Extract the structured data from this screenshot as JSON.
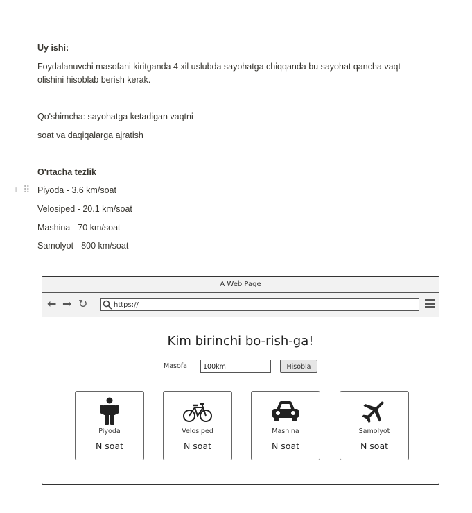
{
  "doc": {
    "heading": "Uy ishi:",
    "task_line1": "Foydalanuvchi masofani kiritganda 4 xil uslubda sayohatga chiqqanda bu sayohat qancha vaqt",
    "task_line2": "olishini hisoblab berish kerak.",
    "extra_line1": "Qo'shimcha: sayohatga ketadigan vaqtni",
    "extra_line2": "soat va daqiqalarga ajratish",
    "speed_heading": "O'rtacha tezlik",
    "speeds": [
      "Piyoda - 3.6 km/soat",
      "Velosiped - 20.1 km/soat",
      "Mashina - 70 km/soat",
      "Samolyot - 800 km/soat"
    ]
  },
  "wireframe": {
    "window_title": "A Web Page",
    "url": "https://",
    "page_heading": "Kim birinchi bo-rish-ga!",
    "distance_label": "Masofa",
    "distance_value": "100km",
    "calc_button": "Hisobla",
    "cards": [
      {
        "name": "Piyoda",
        "value": "N soat",
        "icon": "walking-person-icon"
      },
      {
        "name": "Velosiped",
        "value": "N soat",
        "icon": "bicycle-icon"
      },
      {
        "name": "Mashina",
        "value": "N soat",
        "icon": "car-icon"
      },
      {
        "name": "Samolyot",
        "value": "N soat",
        "icon": "airplane-icon"
      }
    ]
  }
}
